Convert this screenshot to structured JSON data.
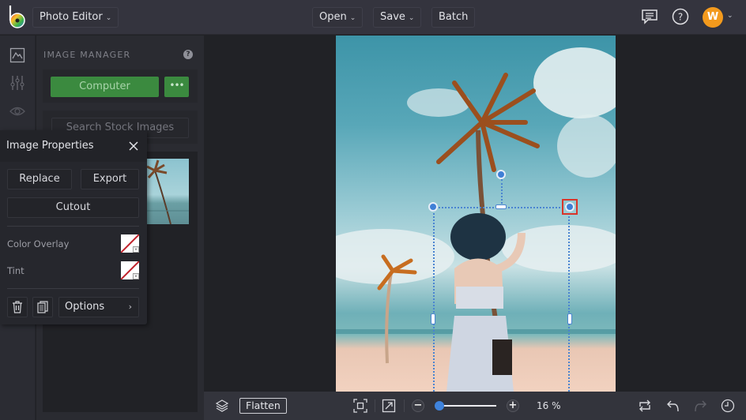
{
  "app": {
    "title": "Photo Editor",
    "menu": {
      "open_label": "Open",
      "save_label": "Save",
      "batch_label": "Batch"
    },
    "user_initial": "W",
    "avatar_color": "#f39a1d"
  },
  "rail": {
    "items": [
      "image-manager",
      "adjustments",
      "preview"
    ]
  },
  "image_manager": {
    "title": "IMAGE MANAGER",
    "help": "?",
    "computer_label": "Computer",
    "more_label": "•••",
    "search_label": "Search Stock Images"
  },
  "image_properties": {
    "title": "Image Properties",
    "replace_label": "Replace",
    "export_label": "Export",
    "cutout_label": "Cutout",
    "color_overlay_label": "Color Overlay",
    "tint_label": "Tint",
    "options_label": "Options",
    "options_arrow": "›"
  },
  "bottombar": {
    "flatten_label": "Flatten",
    "zoom_minus": "−",
    "zoom_plus": "+",
    "zoom_value": "16 %",
    "zoom_percent": 16
  },
  "colors": {
    "accent_green": "#3b8a3f",
    "selection_blue": "#3f7fd6",
    "highlight_red": "#d9352a"
  }
}
